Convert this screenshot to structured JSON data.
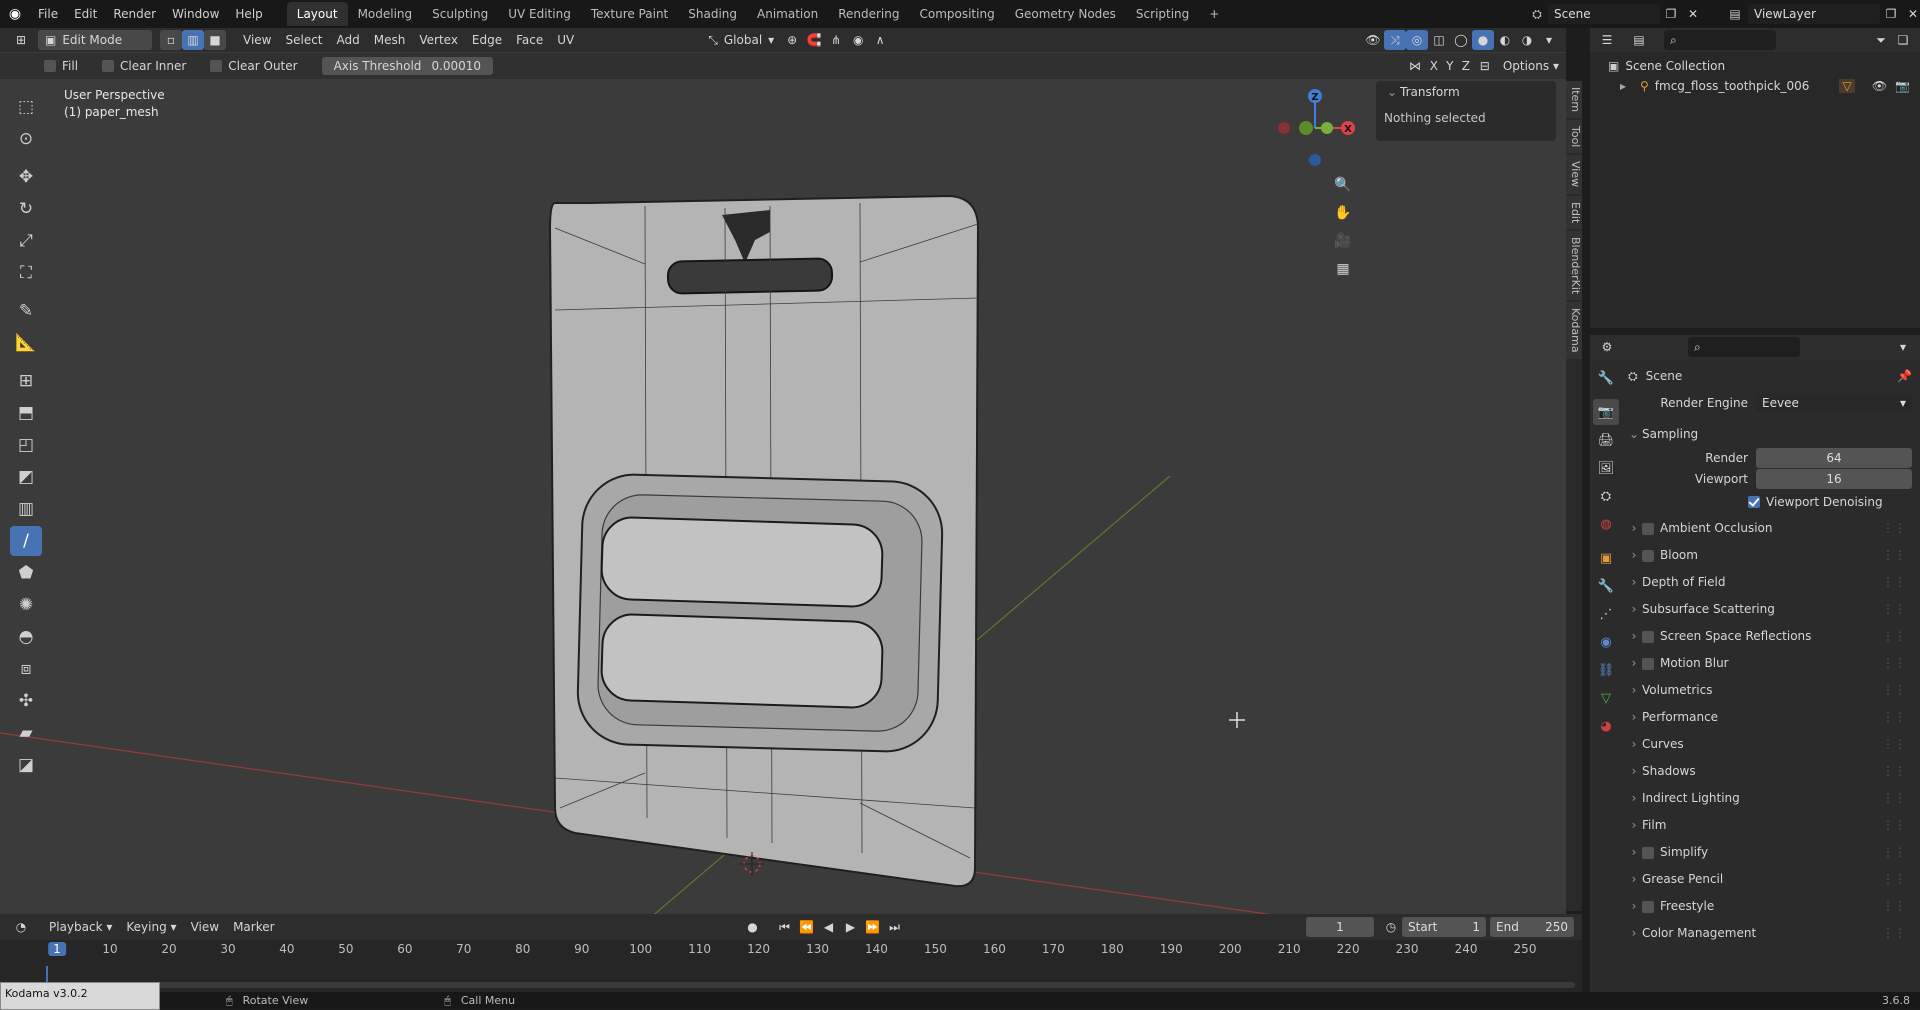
{
  "topbar": {
    "menus": [
      "File",
      "Edit",
      "Render",
      "Window",
      "Help"
    ],
    "workspaces": [
      "Layout",
      "Modeling",
      "Sculpting",
      "UV Editing",
      "Texture Paint",
      "Shading",
      "Animation",
      "Rendering",
      "Compositing",
      "Geometry Nodes",
      "Scripting"
    ],
    "active_workspace": "Layout",
    "add_tab": "+",
    "scene": "Scene",
    "view_layer": "ViewLayer"
  },
  "viewport_header": {
    "mode": "Edit Mode",
    "menus": [
      "View",
      "Select",
      "Add",
      "Mesh",
      "Vertex",
      "Edge",
      "Face",
      "UV"
    ],
    "orientation": "Global"
  },
  "tool_header": {
    "fill": "Fill",
    "clear_inner": "Clear Inner",
    "clear_outer": "Clear Outer",
    "axis_threshold_label": "Axis Threshold",
    "axis_threshold_value": "0.00010",
    "axes": [
      "X",
      "Y",
      "Z"
    ],
    "options": "Options"
  },
  "overlay": {
    "perspective": "User Perspective",
    "object": "(1) paper_mesh"
  },
  "gizmo": {
    "z": "Z",
    "x": "X"
  },
  "npanel": {
    "section": "Transform",
    "message": "Nothing selected",
    "tabs": [
      "Item",
      "Tool",
      "View",
      "Edit",
      "BlenderKit",
      "Kodama"
    ]
  },
  "outliner": {
    "collection": "Scene Collection",
    "object": "fmcg_floss_toothpick_006"
  },
  "properties": {
    "context": "Scene",
    "render_engine_label": "Render Engine",
    "render_engine": "Eevee",
    "sampling": "Sampling",
    "render_label": "Render",
    "render_value": "64",
    "viewport_label": "Viewport",
    "viewport_value": "16",
    "viewport_denoising": "Viewport Denoising",
    "viewport_denoising_checked": true,
    "sections": [
      {
        "label": "Ambient Occlusion",
        "checkbox": true
      },
      {
        "label": "Bloom",
        "checkbox": true
      },
      {
        "label": "Depth of Field",
        "checkbox": false
      },
      {
        "label": "Subsurface Scattering",
        "checkbox": false
      },
      {
        "label": "Screen Space Reflections",
        "checkbox": true
      },
      {
        "label": "Motion Blur",
        "checkbox": true
      },
      {
        "label": "Volumetrics",
        "checkbox": false
      },
      {
        "label": "Performance",
        "checkbox": false
      },
      {
        "label": "Curves",
        "checkbox": false
      },
      {
        "label": "Shadows",
        "checkbox": false
      },
      {
        "label": "Indirect Lighting",
        "checkbox": false
      },
      {
        "label": "Film",
        "checkbox": false
      },
      {
        "label": "Simplify",
        "checkbox": true
      },
      {
        "label": "Grease Pencil",
        "checkbox": false
      },
      {
        "label": "Freestyle",
        "checkbox": true
      },
      {
        "label": "Color Management",
        "checkbox": false
      }
    ]
  },
  "timeline": {
    "menus": [
      "Playback",
      "Keying",
      "View",
      "Marker"
    ],
    "current_frame": "1",
    "start_label": "Start",
    "start": "1",
    "end_label": "End",
    "end": "250",
    "ticks": [
      "1",
      "10",
      "20",
      "30",
      "40",
      "50",
      "60",
      "70",
      "80",
      "90",
      "100",
      "110",
      "120",
      "130",
      "140",
      "150",
      "160",
      "170",
      "180",
      "190",
      "200",
      "210",
      "220",
      "230",
      "240",
      "250"
    ]
  },
  "status": {
    "addon": "Kodama v3.0.2",
    "rotate": "Rotate View",
    "call_menu": "Call Menu",
    "version": "3.6.8"
  },
  "colors": {
    "accent": "#4772b3",
    "x_axis": "#e0414a",
    "y_axis": "#7ab03a",
    "z_axis": "#3f7fd6"
  }
}
